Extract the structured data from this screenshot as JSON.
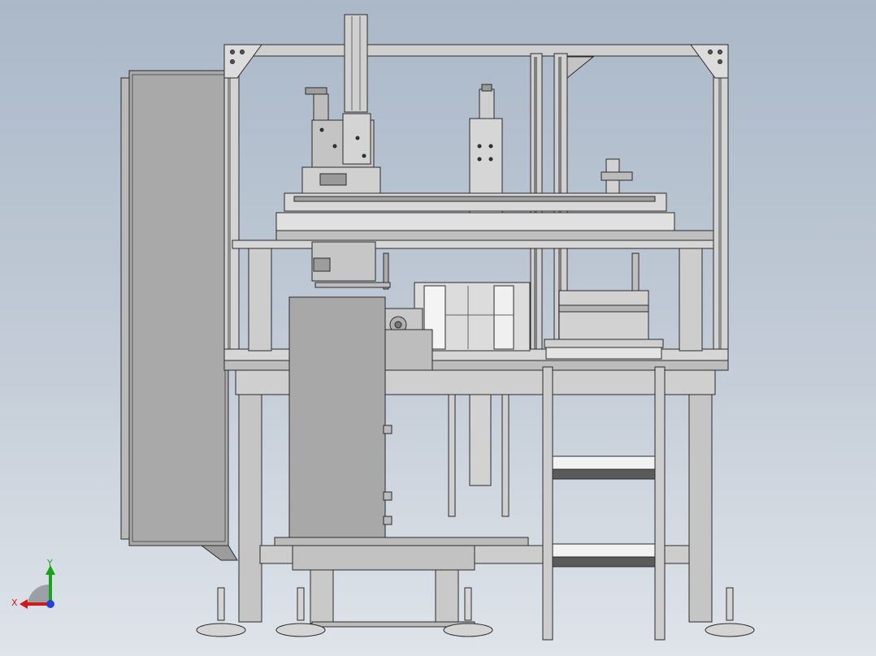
{
  "viewport": {
    "background_top": "#aab8c8",
    "background_bottom": "#dfe4ea"
  },
  "triad": {
    "x_label": "X",
    "y_label": "Y",
    "x_color": "#d11a1a",
    "y_color": "#19a319",
    "z_color": "#2a3fd6"
  },
  "model": {
    "frame_color": "#c9c9c9",
    "panel_color": "#a9a9a9",
    "outline_color": "#2b2b2b"
  }
}
